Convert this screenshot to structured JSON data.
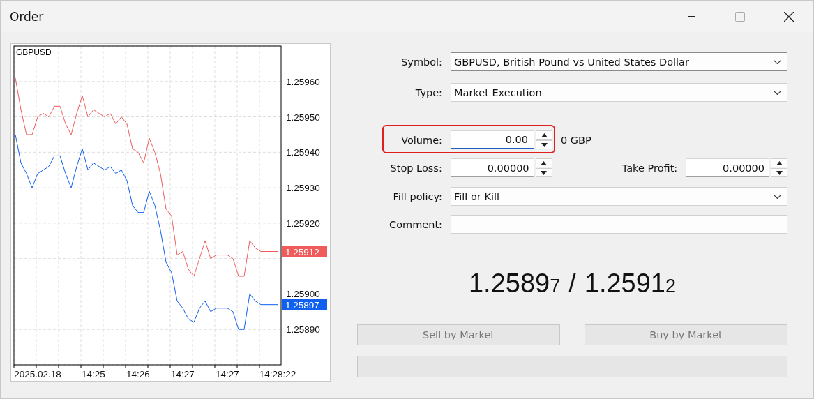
{
  "window": {
    "title": "Order"
  },
  "chart": {
    "chart_data": {
      "type": "line",
      "title": "GBPUSD",
      "grid": true,
      "categories": [
        null,
        null,
        null,
        null,
        "2025.02.18",
        null,
        null,
        null,
        null,
        null,
        null,
        null,
        null,
        null,
        "14:25",
        null,
        null,
        null,
        null,
        null,
        null,
        null,
        "14:26",
        null,
        null,
        null,
        null,
        null,
        null,
        null,
        "14:27",
        null,
        null,
        null,
        null,
        null,
        null,
        null,
        "14:27",
        null,
        null,
        null,
        null,
        null,
        null,
        null,
        null,
        "14:28:22"
      ],
      "ylim": [
        1.2588,
        1.2597
      ],
      "yticks": [
        {
          "value": 1.2596,
          "label": "1.25960"
        },
        {
          "value": 1.2595,
          "label": "1.25950"
        },
        {
          "value": 1.2594,
          "label": "1.25940"
        },
        {
          "value": 1.2593,
          "label": "1.25930"
        },
        {
          "value": 1.2592,
          "label": "1.25920"
        },
        {
          "value": 1.259,
          "label": "1.25900"
        },
        {
          "value": 1.2589,
          "label": "1.25890"
        }
      ],
      "series": [
        {
          "color": "#f05b5b",
          "values": [
            1.25961,
            1.25952,
            1.25945,
            1.25945,
            1.2595,
            1.25951,
            1.2595,
            1.25953,
            1.25953,
            1.25948,
            1.25945,
            1.25951,
            1.25956,
            1.2595,
            1.25952,
            1.25951,
            1.2595,
            1.25951,
            1.25948,
            1.2595,
            1.25948,
            1.25941,
            1.2594,
            1.25937,
            1.25944,
            1.2594,
            1.25934,
            1.25924,
            1.25922,
            1.25911,
            1.25912,
            1.25907,
            1.25905,
            1.2591,
            1.25915,
            1.2591,
            1.25911,
            1.25911,
            1.25911,
            1.2591,
            1.25905,
            1.25905,
            1.25915,
            1.25913,
            1.25912,
            1.25912,
            1.25912,
            1.25912
          ]
        },
        {
          "color": "#1060f0",
          "values": [
            1.25945,
            1.25937,
            1.25934,
            1.2593,
            1.25934,
            1.25935,
            1.25936,
            1.25939,
            1.25939,
            1.25934,
            1.2593,
            1.25936,
            1.25941,
            1.25935,
            1.25937,
            1.25936,
            1.25935,
            1.25936,
            1.25934,
            1.25935,
            1.25932,
            1.25925,
            1.25923,
            1.25923,
            1.25929,
            1.25925,
            1.25918,
            1.25909,
            1.25906,
            1.25898,
            1.25896,
            1.25893,
            1.25892,
            1.25896,
            1.25898,
            1.25895,
            1.25896,
            1.25896,
            1.25896,
            1.25895,
            1.2589,
            1.2589,
            1.259,
            1.25898,
            1.25897,
            1.25897,
            1.25897,
            1.25897
          ]
        }
      ]
    },
    "price_tags": [
      {
        "text": "1.25912",
        "color": "#f05b5b"
      },
      {
        "text": "1.25897",
        "color": "#1060f0"
      }
    ]
  },
  "form": {
    "symbol": {
      "label": "Symbol:",
      "value": "GBPUSD, British Pound vs United States Dollar"
    },
    "type": {
      "label": "Type:",
      "value": "Market Execution"
    },
    "volume": {
      "label": "Volume:",
      "value": "0.00",
      "focused": true,
      "highlighted": true,
      "unit": "0 GBP"
    },
    "stop_loss": {
      "label": "Stop Loss:",
      "value": "0.00000"
    },
    "take_profit": {
      "label": "Take Profit:",
      "value": "0.00000"
    },
    "fill_policy": {
      "label": "Fill policy:",
      "value": "Fill or Kill"
    },
    "comment": {
      "label": "Comment:"
    }
  },
  "quote": {
    "bid": {
      "main": "1.2589",
      "small": "7"
    },
    "separator": "/",
    "ask": {
      "main": "1.2591",
      "small": "2"
    }
  },
  "buttons": [
    {
      "label": "Sell by Market",
      "disabled": true
    },
    {
      "label": "Buy by Market",
      "disabled": true
    }
  ]
}
